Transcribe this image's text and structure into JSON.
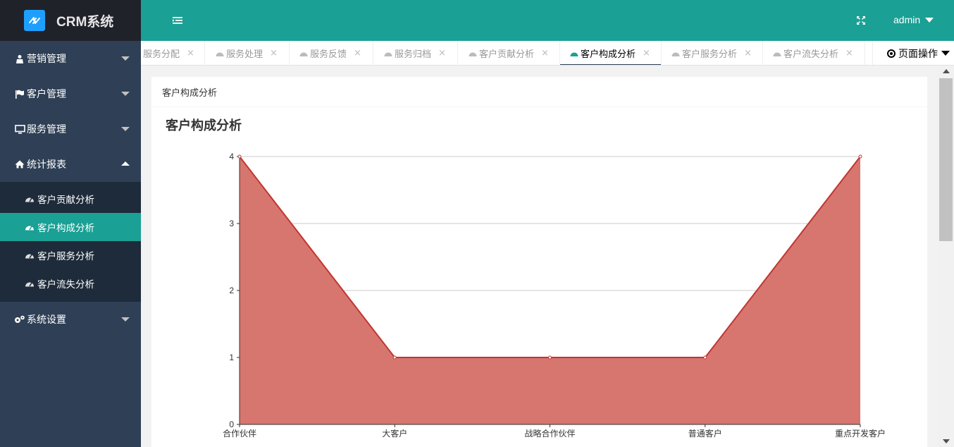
{
  "app": {
    "title": "CRM系统"
  },
  "sidebar": {
    "items": [
      {
        "label": "营销管理",
        "icon": "user-icon",
        "expanded": false
      },
      {
        "label": "客户管理",
        "icon": "flag-icon",
        "expanded": false
      },
      {
        "label": "服务管理",
        "icon": "monitor-icon",
        "expanded": false
      },
      {
        "label": "统计报表",
        "icon": "home-icon",
        "expanded": true
      },
      {
        "label": "系统设置",
        "icon": "gears-icon",
        "expanded": false
      }
    ],
    "sub_items": [
      {
        "label": "客户贡献分析",
        "active": false
      },
      {
        "label": "客户构成分析",
        "active": true
      },
      {
        "label": "客户服务分析",
        "active": false
      },
      {
        "label": "客户流失分析",
        "active": false
      }
    ]
  },
  "header": {
    "user": "admin"
  },
  "tabs": [
    {
      "label": "服务分配",
      "has_icon": false,
      "active": false
    },
    {
      "label": "服务处理",
      "has_icon": true,
      "active": false
    },
    {
      "label": "服务反馈",
      "has_icon": true,
      "active": false
    },
    {
      "label": "服务归档",
      "has_icon": true,
      "active": false
    },
    {
      "label": "客户贡献分析",
      "has_icon": true,
      "active": false
    },
    {
      "label": "客户构成分析",
      "has_icon": true,
      "active": true
    },
    {
      "label": "客户服务分析",
      "has_icon": true,
      "active": false
    },
    {
      "label": "客户流失分析",
      "has_icon": true,
      "active": false
    }
  ],
  "tab_close": "×",
  "page_ops": {
    "label": "页面操作"
  },
  "card": {
    "header": "客户构成分析"
  },
  "colors": {
    "accent": "#1aa094",
    "sidebar": "#2f4056",
    "area_fill": "#d7766f",
    "line": "#c23531"
  },
  "chart_data": {
    "type": "area",
    "title": "客户构成分析",
    "categories": [
      "合作伙伴",
      "大客户",
      "战略合作伙伴",
      "普通客户",
      "重点开发客户"
    ],
    "values": [
      4,
      1,
      1,
      1,
      4
    ],
    "ylim": [
      0,
      4
    ],
    "yticks": [
      0,
      1,
      2,
      3,
      4
    ],
    "grid": true
  }
}
